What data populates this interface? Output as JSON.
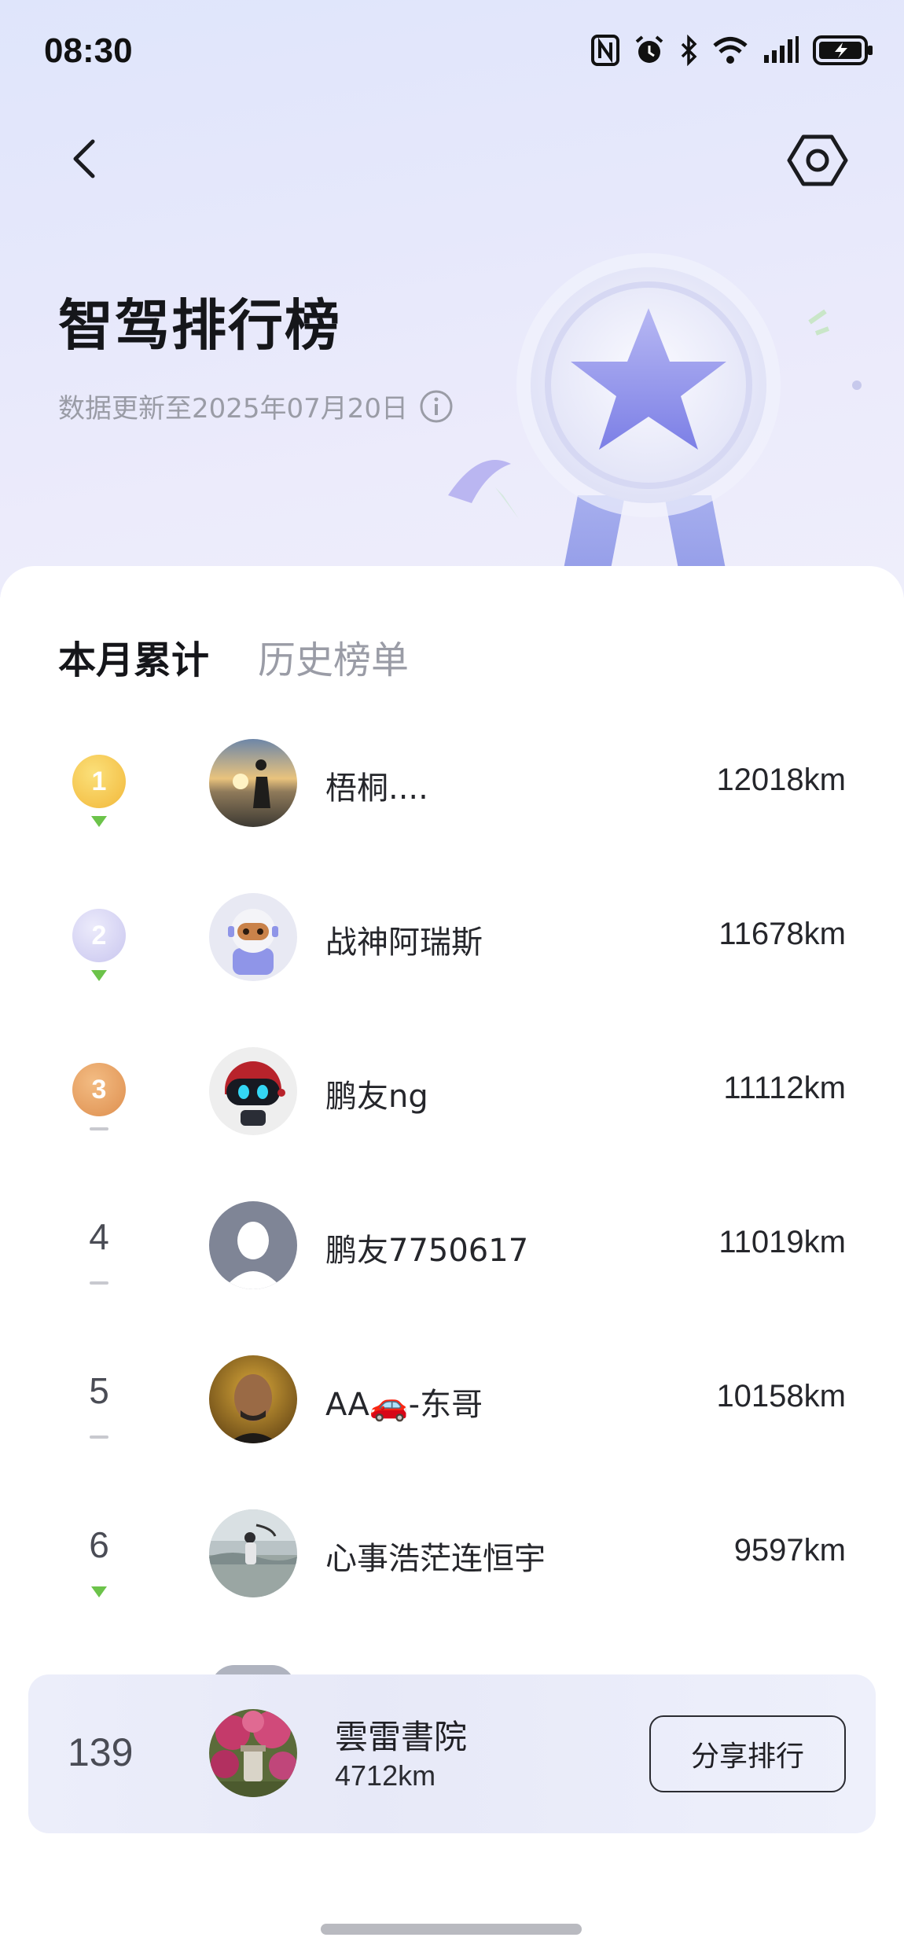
{
  "status_bar": {
    "time": "08:30",
    "icons": [
      "nfc-icon",
      "alarm-icon",
      "bluetooth-icon",
      "wifi-icon",
      "signal-icon",
      "battery-icon"
    ]
  },
  "header": {
    "title": "智驾排行榜",
    "update_text": "数据更新至2025年07月20日",
    "back_icon": "back-arrow-icon",
    "settings_icon": "settings-hexagon-icon"
  },
  "tabs": [
    {
      "label": "本月累计",
      "active": true
    },
    {
      "label": "历史榜单",
      "active": false
    }
  ],
  "rankings": [
    {
      "rank": "1",
      "name": "梧桐....",
      "distance": "12018km",
      "trend": "up",
      "medal": "gold"
    },
    {
      "rank": "2",
      "name": "战神阿瑞斯",
      "distance": "11678km",
      "trend": "up",
      "medal": "silver"
    },
    {
      "rank": "3",
      "name": "鹏友ng",
      "distance": "11112km",
      "trend": "flat",
      "medal": "bronze"
    },
    {
      "rank": "4",
      "name": "鹏友7750617",
      "distance": "11019km",
      "trend": "flat"
    },
    {
      "rank": "5",
      "name": "AA🚗-东哥",
      "distance": "10158km",
      "trend": "flat"
    },
    {
      "rank": "6",
      "name": "心事浩茫连恒宇",
      "distance": "9597km",
      "trend": "up"
    }
  ],
  "my_rank": {
    "rank": "139",
    "name": "雲雷書院",
    "distance": "4712km",
    "share_label": "分享排行"
  },
  "colors": {
    "gold": "#f2b83a",
    "silver": "#c9c6ef",
    "bronze": "#de8f4f",
    "trend_up": "#6cc34a",
    "hero_bg": "#e3e7fb"
  }
}
